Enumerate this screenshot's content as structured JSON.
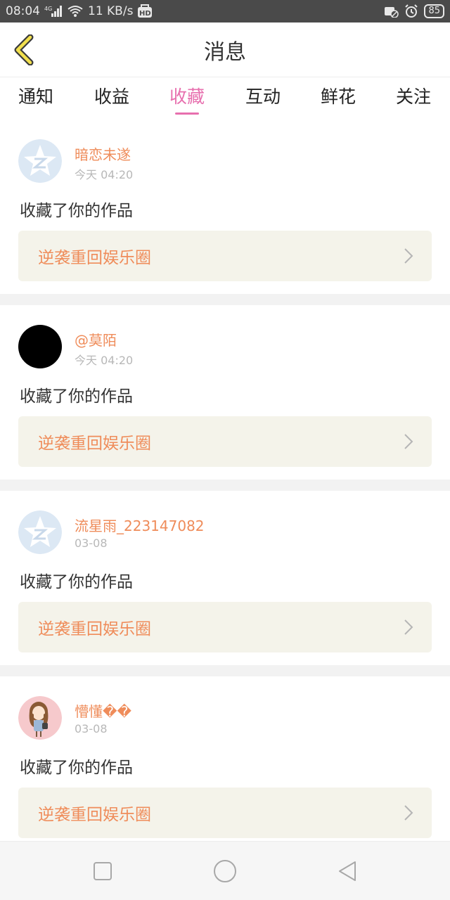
{
  "status_bar": {
    "time": "08:04",
    "network_type": "4G",
    "speed": "11 KB/s",
    "hd_badge": "HD",
    "battery": "85",
    "icons": [
      "signal-icon",
      "wifi-icon",
      "hd-icon",
      "no-sim-icon",
      "alarm-icon",
      "battery-icon"
    ]
  },
  "header": {
    "title": "消息",
    "back_icon": "chevron-left-icon"
  },
  "tabs": [
    {
      "label": "通知",
      "active": false
    },
    {
      "label": "收益",
      "active": false
    },
    {
      "label": "收藏",
      "active": true
    },
    {
      "label": "互动",
      "active": false
    },
    {
      "label": "鲜花",
      "active": false
    },
    {
      "label": "关注",
      "active": false
    }
  ],
  "items": [
    {
      "username": "暗恋未遂",
      "time": "今天 04:20",
      "action": "收藏了你的作品",
      "work_title": "逆袭重回娱乐圈",
      "avatar": "qzone-star-avatar"
    },
    {
      "username": "@莫陌",
      "time": "今天 04:20",
      "action": "收藏了你的作品",
      "work_title": "逆袭重回娱乐圈",
      "avatar": "black-circle-avatar"
    },
    {
      "username": "流星雨_223147082",
      "time": "03-08",
      "action": "收藏了你的作品",
      "work_title": "逆袭重回娱乐圈",
      "avatar": "qzone-star-avatar"
    },
    {
      "username": "懵懂��",
      "time": "03-08",
      "action": "收藏了你的作品",
      "work_title": "逆袭重回娱乐圈",
      "avatar": "cartoon-girl-avatar"
    }
  ],
  "colors": {
    "accent": "#e76fae",
    "username": "#ef8c5a",
    "link_bg": "#f4f3ea",
    "status_bar": "#4a4a4a"
  },
  "bottom_nav": {
    "icons": [
      "recent-apps-square-icon",
      "home-circle-icon",
      "back-triangle-icon"
    ]
  }
}
